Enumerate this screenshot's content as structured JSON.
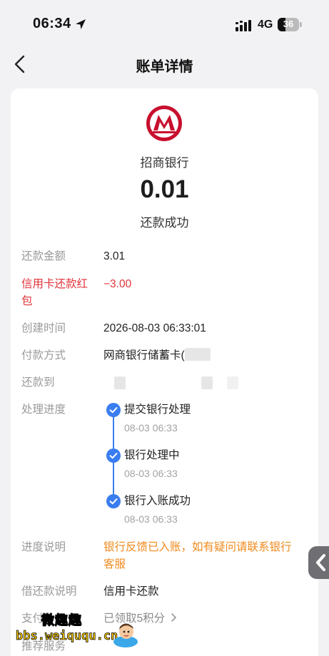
{
  "status_bar": {
    "time": "06:34",
    "network": "4G",
    "battery": "36",
    "battery_fraction": 0.36
  },
  "nav": {
    "title": "账单详情"
  },
  "card": {
    "bank_name": "招商银行",
    "amount": "0.01",
    "status": "还款成功"
  },
  "details": {
    "repay_amount": {
      "label": "还款金额",
      "value": "3.01"
    },
    "red_packet": {
      "label_line1": "信用卡还款红",
      "label_line2": "包",
      "value": "−3.00"
    },
    "created_time": {
      "label": "创建时间",
      "value": "2026-08-03 06:33:01"
    },
    "payment_method": {
      "label": "付款方式",
      "value": "网商银行储蓄卡("
    },
    "repay_to": {
      "label": "还款到"
    },
    "progress": {
      "label": "处理进度",
      "steps": [
        {
          "title": "提交银行处理",
          "time": "08-03 06:33"
        },
        {
          "title": "银行处理中",
          "time": "08-03 06:33"
        },
        {
          "title": "银行入账成功",
          "time": "08-03 06:33"
        }
      ]
    },
    "progress_note": {
      "label": "进度说明",
      "value_line1": "银行反馈已入账，如有疑问请联系银行",
      "value_line2": "客服"
    },
    "loan_note": {
      "label": "借还款说明",
      "value": "信用卡还款"
    },
    "payment_reward": {
      "label": "支付",
      "value": "已领取5积分"
    },
    "recommend": {
      "label": "推荐服务"
    }
  },
  "watermark": {
    "title": "微趣趣",
    "url": "bbs.weiququ.cn"
  },
  "colors": {
    "accent_blue": "#3a7df0",
    "red": "#e0333a",
    "orange": "#f08a1e",
    "logo_red": "#c8102e"
  }
}
